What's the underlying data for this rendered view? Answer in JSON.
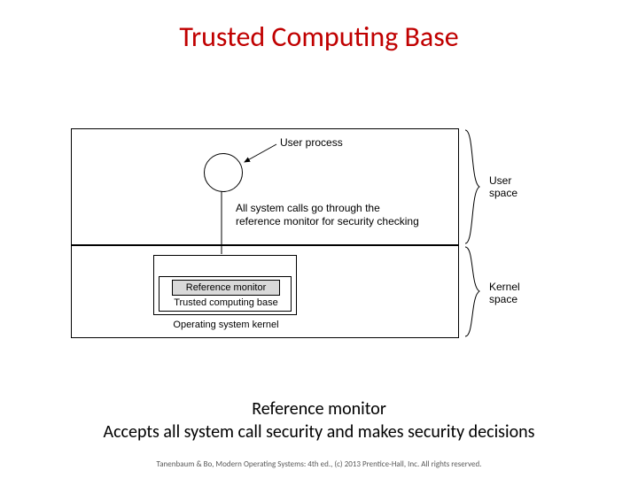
{
  "title": "Trusted Computing Base",
  "diagram": {
    "user_process": "User process",
    "arrow_caption_l1": "All system calls go through the",
    "arrow_caption_l2": "reference monitor for security checking",
    "reference_monitor": "Reference monitor",
    "tcb": "Trusted computing base",
    "os_kernel": "Operating system kernel",
    "user_space_l1": "User",
    "user_space_l2": "space",
    "kernel_space_l1": "Kernel",
    "kernel_space_l2": "space"
  },
  "caption_line1": "Reference monitor",
  "caption_line2": "Accepts all system call security and makes security decisions",
  "footer": "Tanenbaum & Bo, Modern Operating Systems: 4th ed., (c) 2013 Prentice-Hall, Inc. All rights reserved."
}
